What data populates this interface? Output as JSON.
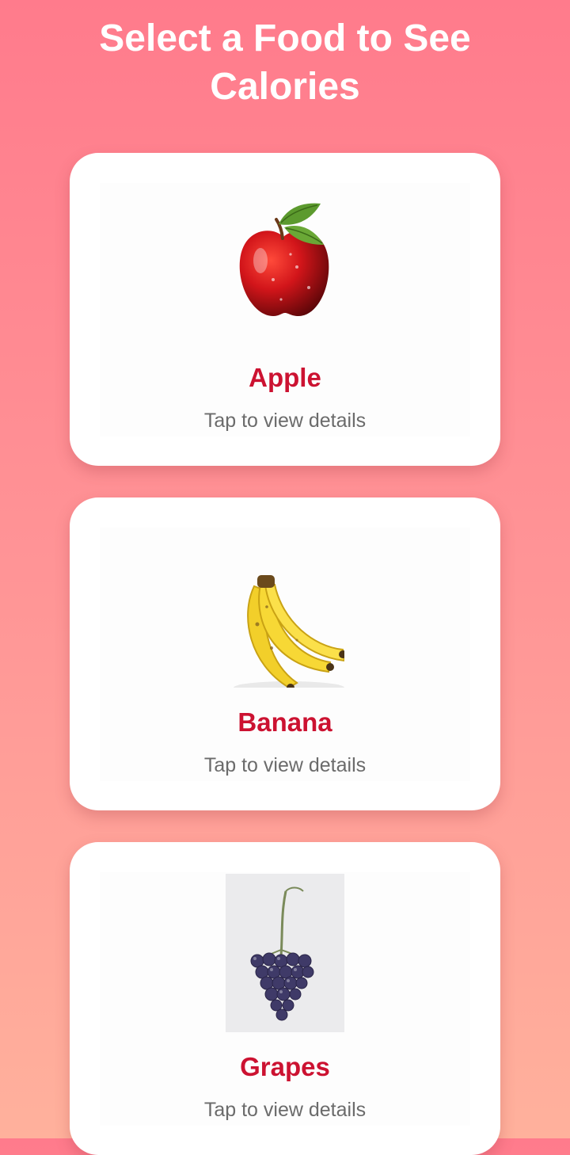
{
  "header": {
    "title": "Select a Food to See Calories"
  },
  "foods": [
    {
      "name": "Apple",
      "hint": "Tap to view details",
      "icon": "apple-image"
    },
    {
      "name": "Banana",
      "hint": "Tap to view details",
      "icon": "banana-image"
    },
    {
      "name": "Grapes",
      "hint": "Tap to view details",
      "icon": "grapes-image"
    }
  ],
  "colors": {
    "accent": "#cc1231",
    "hint": "#6b6b6b",
    "background_top": "#ff7b8c",
    "background_bottom": "#ffb19c"
  }
}
